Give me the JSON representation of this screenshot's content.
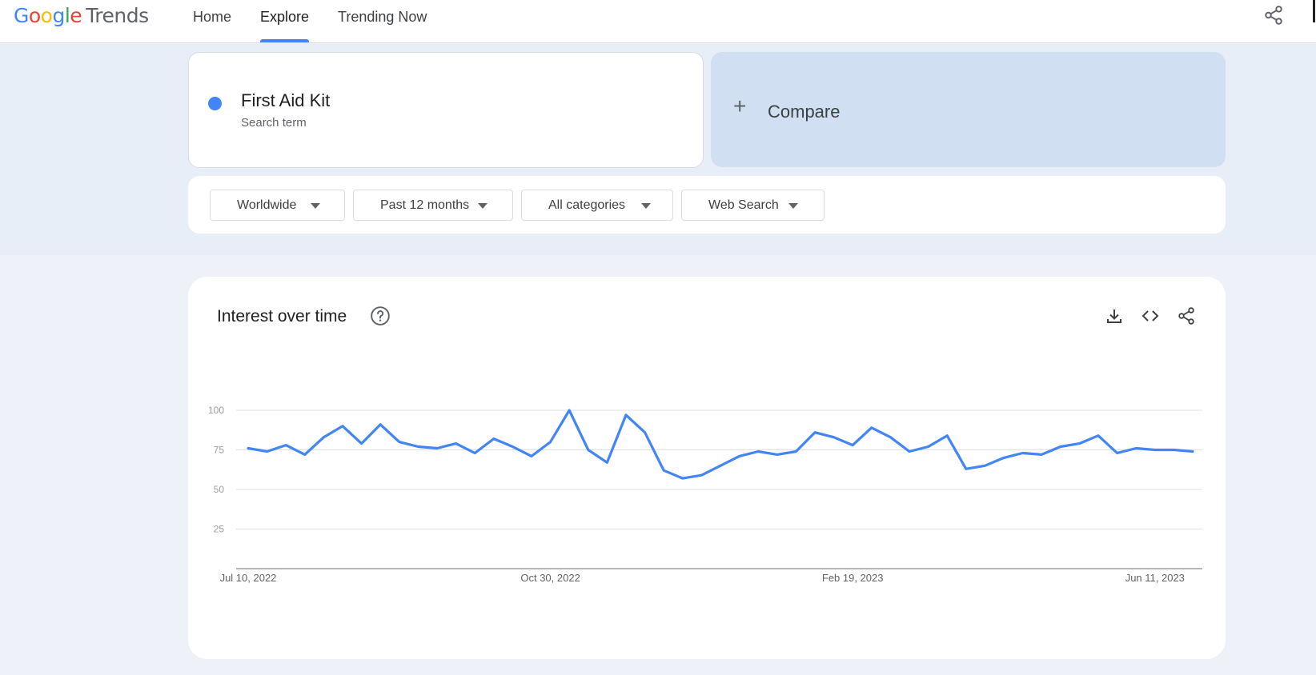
{
  "header": {
    "logo_text": "Google Trends",
    "nav": [
      {
        "label": "Home",
        "active": false
      },
      {
        "label": "Explore",
        "active": true
      },
      {
        "label": "Trending Now",
        "active": false
      }
    ],
    "share_icon": "share-icon",
    "accent_color": "#4285f4"
  },
  "search": {
    "term": "First Aid Kit",
    "term_type": "Search term",
    "term_color": "#4285f4",
    "compare_label": "Compare"
  },
  "filters": [
    {
      "label": "Worldwide"
    },
    {
      "label": "Past 12 months"
    },
    {
      "label": "All categories"
    },
    {
      "label": "Web Search"
    }
  ],
  "interest_card": {
    "title": "Interest over time",
    "help_icon": "help-circle-icon",
    "tools": [
      "download-icon",
      "embed-code-icon",
      "share-icon"
    ]
  },
  "chart_data": {
    "type": "line",
    "title": "Interest over time",
    "xlabel": "",
    "ylabel": "",
    "ylim": [
      0,
      100
    ],
    "y_ticks": [
      25,
      50,
      75,
      100
    ],
    "x_tick_labels": [
      "Jul 10, 2022",
      "Oct 30, 2022",
      "Feb 19, 2023",
      "Jun 11, 2023"
    ],
    "x_start": "Jul 10, 2022",
    "x_interval": "weekly",
    "grid": true,
    "series": [
      {
        "color": "#4285f4",
        "values": [
          76,
          74,
          78,
          72,
          83,
          90,
          79,
          91,
          80,
          77,
          76,
          79,
          73,
          82,
          77,
          71,
          80,
          100,
          75,
          67,
          97,
          86,
          62,
          57,
          59,
          65,
          71,
          74,
          72,
          74,
          86,
          83,
          78,
          89,
          83,
          74,
          77,
          84,
          63,
          65,
          70,
          73,
          72,
          77,
          79,
          84,
          73,
          76,
          75,
          75,
          74
        ]
      }
    ]
  }
}
